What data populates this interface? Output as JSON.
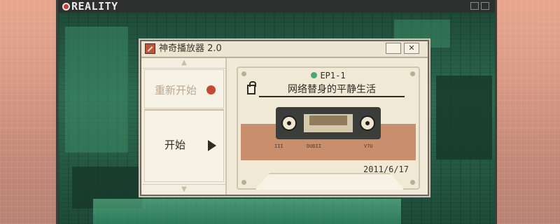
{
  "reality_window": {
    "title": "REALITY"
  },
  "player": {
    "title": "神奇播放器 2.0",
    "close_glyph": "✕",
    "menu": {
      "up_arrow": "▲",
      "down_arrow": "▼",
      "items": [
        {
          "label": "重新开始"
        },
        {
          "label": "开始"
        }
      ]
    },
    "cassette": {
      "episode": "EP1-1",
      "song_title": "网络替身的平静生活",
      "date": "2011/6/17",
      "marks": [
        "III",
        "DUDII",
        "V7U"
      ]
    }
  },
  "colors": {
    "accent_red": "#c44a32",
    "episode_green": "#4aa672",
    "tape_orange": "#c98e6b"
  }
}
